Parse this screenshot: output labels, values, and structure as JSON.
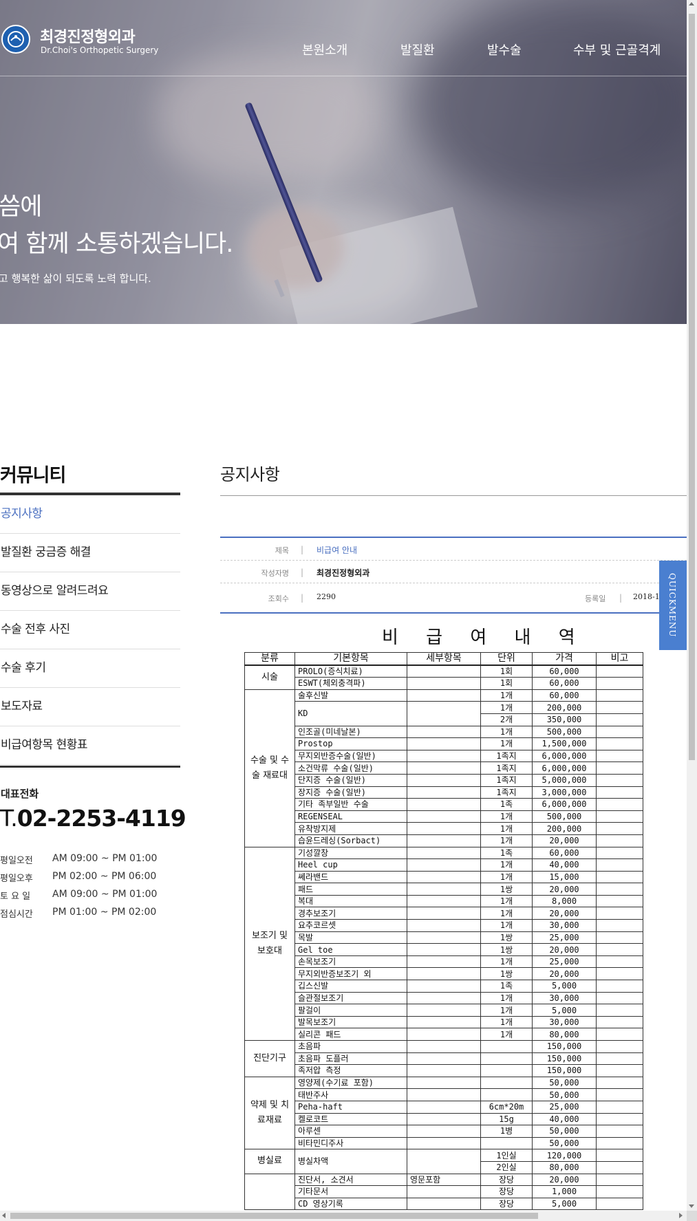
{
  "header": {
    "logo_kr": "최경진정형외과",
    "logo_en": "Dr.Choi's Orthopetic Surgery",
    "nav": [
      "본원소개",
      "발질환",
      "발수술",
      "수부 및 근골격계"
    ]
  },
  "hero": {
    "line1": "씀에",
    "line2": "여 함께 소통하겠습니다.",
    "sub": "고 행복한 삶이 되도록 노력 합니다."
  },
  "sidebar": {
    "title": "커뮤니티",
    "items": [
      {
        "label": "공지사항",
        "active": true
      },
      {
        "label": "발질환 궁금증 해결"
      },
      {
        "label": "동영상으로 알려드려요"
      },
      {
        "label": "수술 전후 사진"
      },
      {
        "label": "수술 후기"
      },
      {
        "label": "보도자료"
      },
      {
        "label": "비급여항목 현황표"
      }
    ],
    "tel_label": "대표전화",
    "tel_prefix": "T.",
    "tel_number": "02-2253-4119",
    "hours": [
      {
        "day": "평일오전",
        "time": "AM 09:00 ~ PM 01:00"
      },
      {
        "day": "평일오후",
        "time": "PM 02:00 ~ PM 06:00"
      },
      {
        "day": "토 요 일",
        "time": "AM 09:00 ~ PM 01:00"
      },
      {
        "day": "점심시간",
        "time": "PM 01:00 ~ PM 02:00"
      }
    ]
  },
  "main": {
    "title": "공지사항",
    "subject_label": "제목",
    "subject": "비급여 안내",
    "author_label": "작성자명",
    "author": "최경진정형외과",
    "views_label": "조회수",
    "views": "2290",
    "date_label": "등록일",
    "date": "2018-10"
  },
  "quickmenu": "QUICKMENU",
  "fee_table": {
    "title": "비 급 여 내 역",
    "headers": [
      "분류",
      "기본항목",
      "세부항목",
      "단위",
      "가격",
      "비고"
    ],
    "groups": [
      {
        "cat": "시술",
        "rows": [
          [
            "PROLO(증식치료)",
            "",
            "1회",
            "60,000"
          ],
          [
            "ESWT(체외충격파)",
            "",
            "1회",
            "60,000"
          ]
        ]
      },
      {
        "cat": "수술 및 수술 재료대",
        "rows": [
          [
            "술후신발",
            "",
            "1개",
            "60,000"
          ],
          [
            "KD",
            "",
            "1개",
            "200,000"
          ],
          [
            "",
            "",
            "2개",
            "350,000"
          ],
          [
            "인조골(미네날본)",
            "",
            "1개",
            "500,000"
          ],
          [
            "Prostop",
            "",
            "1개",
            "1,500,000"
          ],
          [
            "무지외반증수술(일반)",
            "",
            "1족지",
            "6,000,000"
          ],
          [
            "소건막류 수술(일반)",
            "",
            "1족지",
            "6,000,000"
          ],
          [
            "단지증 수술(일반)",
            "",
            "1족지",
            "5,000,000"
          ],
          [
            "장지증 수술(일반)",
            "",
            "1족지",
            "3,000,000"
          ],
          [
            "기타 족부일반 수술",
            "",
            "1족",
            "6,000,000"
          ],
          [
            "REGENSEAL",
            "",
            "1개",
            "500,000"
          ],
          [
            "유착방지제",
            "",
            "1개",
            "200,000"
          ],
          [
            "습윤드레싱(Sorbact)",
            "",
            "1개",
            "20,000"
          ]
        ]
      },
      {
        "cat": "보조기 및 보호대",
        "rows": [
          [
            "기성깔창",
            "",
            "1족",
            "60,000"
          ],
          [
            "Heel cup",
            "",
            "1개",
            "40,000"
          ],
          [
            "쎄라밴드",
            "",
            "1개",
            "15,000"
          ],
          [
            "패드",
            "",
            "1쌍",
            "20,000"
          ],
          [
            "복대",
            "",
            "1개",
            "8,000"
          ],
          [
            "경추보조기",
            "",
            "1개",
            "20,000"
          ],
          [
            "요추코르셋",
            "",
            "1개",
            "30,000"
          ],
          [
            "목발",
            "",
            "1쌍",
            "25,000"
          ],
          [
            "Gel toe",
            "",
            "1쌍",
            "20,000"
          ],
          [
            "손목보조기",
            "",
            "1개",
            "25,000"
          ],
          [
            "무지외반증보조기 외",
            "",
            "1쌍",
            "20,000"
          ],
          [
            "깁스신발",
            "",
            "1족",
            "5,000"
          ],
          [
            "슬관절보조기",
            "",
            "1개",
            "30,000"
          ],
          [
            "팔걸이",
            "",
            "1개",
            "5,000"
          ],
          [
            "발목보조기",
            "",
            "1개",
            "30,000"
          ],
          [
            "실리콘 패드",
            "",
            "1개",
            "80,000"
          ]
        ]
      },
      {
        "cat": "진단기구",
        "rows": [
          [
            "초음파",
            "",
            "",
            "150,000"
          ],
          [
            "초음파 도플러",
            "",
            "",
            "150,000"
          ],
          [
            "족저압 측정",
            "",
            "",
            "150,000"
          ]
        ]
      },
      {
        "cat": "약제 및 치료재료",
        "rows": [
          [
            "영양제(수기료 포함)",
            "",
            "",
            "50,000"
          ],
          [
            "태반주사",
            "",
            "",
            "50,000"
          ],
          [
            "Peha-haft",
            "",
            "6cm*20m",
            "25,000"
          ],
          [
            "켈로코트",
            "",
            "15g",
            "40,000"
          ],
          [
            "아루센",
            "",
            "1병",
            "50,000"
          ],
          [
            "비타민디주사",
            "",
            "",
            "50,000"
          ]
        ]
      },
      {
        "cat": "병실료",
        "rows": [
          [
            "병실차액",
            "",
            "1인실",
            "120,000"
          ],
          [
            "",
            "",
            "2인실",
            "80,000"
          ]
        ]
      },
      {
        "cat": "",
        "rows": [
          [
            "진단서, 소견서",
            "영문포함",
            "장당",
            "20,000"
          ],
          [
            "기타문서",
            "",
            "장당",
            "1,000"
          ],
          [
            "CD 영상기록",
            "",
            "장당",
            "5,000"
          ]
        ]
      }
    ]
  }
}
